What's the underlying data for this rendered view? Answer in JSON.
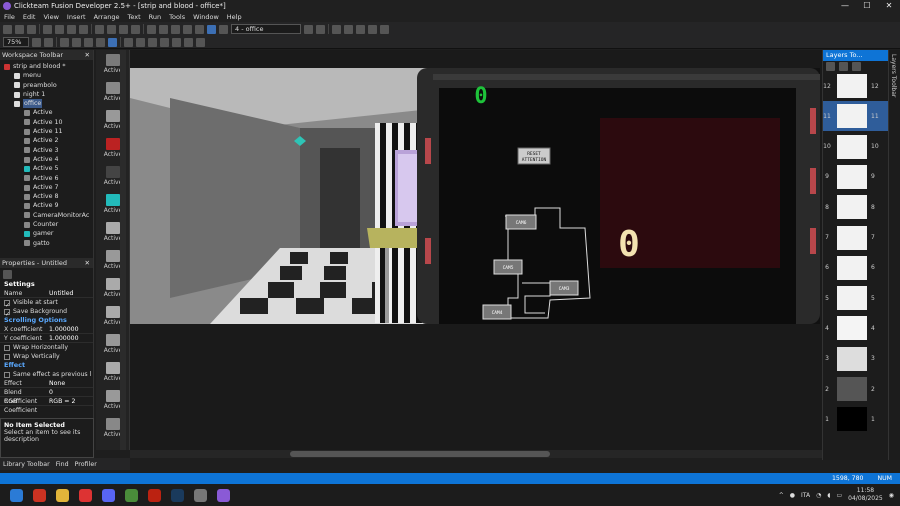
{
  "window": {
    "title": "Clickteam Fusion Developer 2.5+ - [strip and blood - office*]",
    "controls": [
      "—",
      "☐",
      "✕"
    ]
  },
  "menu": [
    "File",
    "Edit",
    "View",
    "Insert",
    "Arrange",
    "Text",
    "Run",
    "Tools",
    "Window",
    "Help"
  ],
  "toolbar": {
    "frame_combo": "4 - office",
    "zoom": "75%"
  },
  "workspace": {
    "title": "Workspace Toolbar",
    "items": [
      {
        "label": "strip and blood *",
        "indent": 1,
        "color": "#c33"
      },
      {
        "label": "menu",
        "indent": 2,
        "color": "#ddd"
      },
      {
        "label": "preambolo",
        "indent": 2,
        "color": "#ddd"
      },
      {
        "label": "night 1",
        "indent": 2,
        "color": "#ddd"
      },
      {
        "label": "office",
        "indent": 2,
        "color": "#ddd",
        "selected": true
      },
      {
        "label": "Active",
        "indent": 3,
        "color": "#888"
      },
      {
        "label": "Active 10",
        "indent": 3,
        "color": "#888"
      },
      {
        "label": "Active 11",
        "indent": 3,
        "color": "#888"
      },
      {
        "label": "Active 2",
        "indent": 3,
        "color": "#888"
      },
      {
        "label": "Active 3",
        "indent": 3,
        "color": "#888"
      },
      {
        "label": "Active 4",
        "indent": 3,
        "color": "#888"
      },
      {
        "label": "Active 5",
        "indent": 3,
        "color": "#2bb"
      },
      {
        "label": "Active 6",
        "indent": 3,
        "color": "#888"
      },
      {
        "label": "Active 7",
        "indent": 3,
        "color": "#888"
      },
      {
        "label": "Active 8",
        "indent": 3,
        "color": "#888"
      },
      {
        "label": "Active 9",
        "indent": 3,
        "color": "#888"
      },
      {
        "label": "CameraMonitorAc",
        "indent": 3,
        "color": "#888"
      },
      {
        "label": "Counter",
        "indent": 3,
        "color": "#888"
      },
      {
        "label": "gamer",
        "indent": 3,
        "color": "#2bb"
      },
      {
        "label": "gatto",
        "indent": 3,
        "color": "#888"
      }
    ]
  },
  "objects": [
    "Active",
    "Active",
    "Active",
    "Active",
    "Active",
    "Active",
    "Active",
    "Active",
    "Active",
    "Active",
    "Active",
    "Active",
    "Active",
    "Active"
  ],
  "properties": {
    "title": "Properties - Untitled",
    "settings_label": "Settings",
    "name_key": "Name",
    "name_val": "Untitled",
    "visible": "Visible at start",
    "savebg": "Save Background",
    "scroll_label": "Scrolling Options",
    "xcoef_k": "X coefficient",
    "xcoef_v": "1.000000",
    "ycoef_k": "Y coefficient",
    "ycoef_v": "1.000000",
    "wraph": "Wrap Horizontally",
    "wrapv": "Wrap Vertically",
    "effect_label": "Effect",
    "same": "Same effect as previous l",
    "eff_k": "Effect",
    "eff_v": "None",
    "blend_k": "Blend Coefficient",
    "blend_v": "0",
    "rgb_k": "RGB Coefficient",
    "rgb_v": "RGB = 2"
  },
  "info": {
    "title": "No Item Selected",
    "desc": "Select an item to see its description"
  },
  "bottom_tabs": [
    "Library Toolbar",
    "Find",
    "Profiler"
  ],
  "scene": {
    "counter_top": "0",
    "counter_main": "0",
    "reset_button": "RESET\nATTENTION",
    "cams": [
      "CAM6",
      "CAM5",
      "CAM3",
      "CAM4"
    ]
  },
  "layers": {
    "title": "Layers To...",
    "vertical_title": "Layers Toolbar",
    "rows": [
      12,
      11,
      10,
      9,
      8,
      7,
      6,
      5,
      4,
      3,
      2,
      1
    ],
    "selected": 11
  },
  "status": {
    "coords": "1598, 780",
    "caps": "NUM"
  },
  "taskbar": {
    "lang": "ITA",
    "time": "11:58",
    "date": "04/08/2025"
  }
}
